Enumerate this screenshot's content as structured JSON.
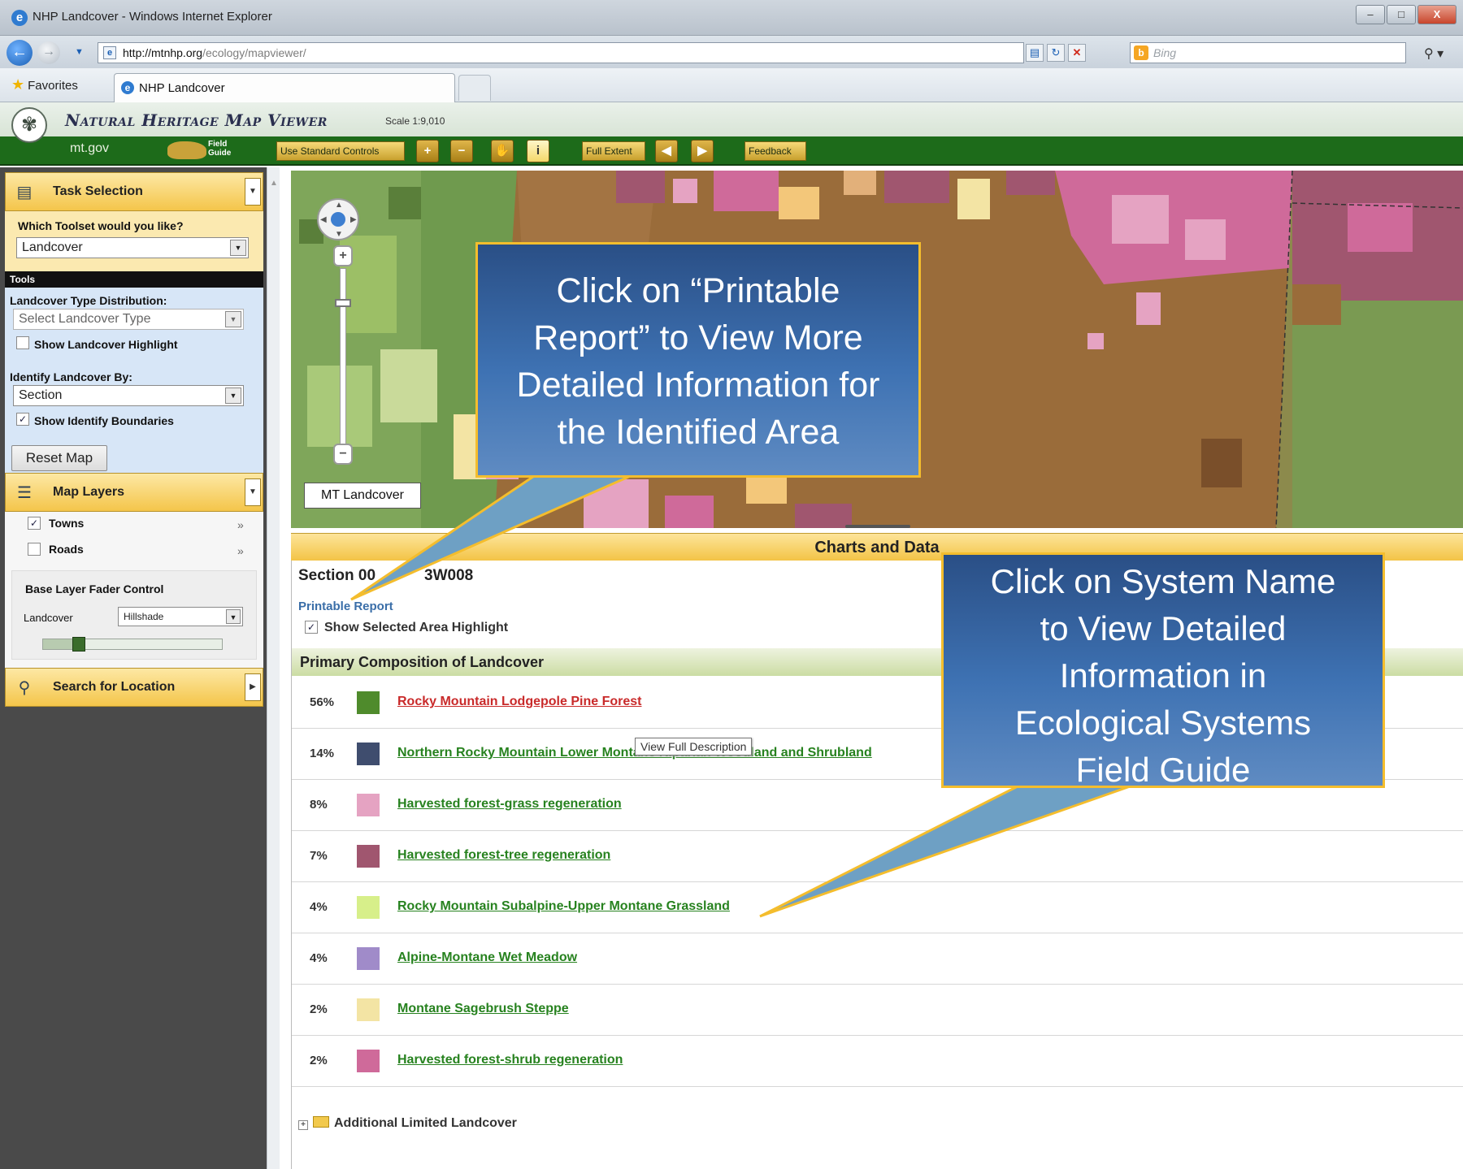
{
  "browser": {
    "window_title": "NHP Landcover - Windows Internet Explorer",
    "url_domain": "http://mtnhp.org",
    "url_path": "/ecology/mapviewer/",
    "search_placeholder": "Bing",
    "favorites_label": "Favorites",
    "tab_label": "NHP Landcover",
    "window_buttons": [
      "–",
      "□",
      "X"
    ]
  },
  "app": {
    "title": "Natural Heritage Map Viewer",
    "scale": "Scale 1:9,010",
    "mtgov": "mt.gov",
    "field_guide": "Field Guide",
    "toolbar": {
      "standard_controls": "Use Standard Controls",
      "full_extent": "Full Extent",
      "feedback": "Feedback"
    }
  },
  "panel": {
    "task_selection": "Task Selection",
    "toolset_question": "Which Toolset would you like?",
    "toolset_value": "Landcover",
    "tools_heading": "Tools",
    "distribution_label": "Landcover Type Distribution:",
    "distribution_placeholder": "Select Landcover Type",
    "show_highlight": "Show Landcover Highlight",
    "identify_label": "Identify Landcover By:",
    "identify_value": "Section",
    "show_boundaries": "Show Identify Boundaries",
    "reset_map": "Reset Map",
    "map_layers": "Map Layers",
    "layers": [
      {
        "label": "Towns",
        "checked": true
      },
      {
        "label": "Roads",
        "checked": false
      }
    ],
    "fader_heading": "Base Layer Fader Control",
    "fader_left": "Landcover",
    "fader_right": "Hillshade",
    "fader_level": 0.2,
    "search_location": "Search for Location"
  },
  "map": {
    "layer_label": "MT Landcover"
  },
  "charts": {
    "header": "Charts and Data",
    "section_title": "Section 00",
    "section_title_end": "3W008",
    "printable_report": "Printable Report",
    "show_selected": "Show Selected Area Highlight",
    "composition_header": "Primary Composition of Landcover",
    "tooltip": "View Full Description",
    "rows": [
      {
        "pct": "56%",
        "color": "#4f8b2c",
        "name": "Rocky Mountain Lodgepole Pine Forest",
        "hover": true
      },
      {
        "pct": "14%",
        "color": "#3f4d6e",
        "name": "Northern Rocky Mountain Lower Montane Riparian Woodland and Shrubland",
        "hover": false
      },
      {
        "pct": "8%",
        "color": "#e5a3c2",
        "name": "Harvested forest-grass regeneration",
        "hover": false
      },
      {
        "pct": "7%",
        "color": "#a0566f",
        "name": "Harvested forest-tree regeneration",
        "hover": false
      },
      {
        "pct": "4%",
        "color": "#d7ef8a",
        "name": "Rocky Mountain Subalpine-Upper Montane Grassland",
        "hover": false
      },
      {
        "pct": "4%",
        "color": "#a08bc9",
        "name": "Alpine-Montane Wet Meadow",
        "hover": false
      },
      {
        "pct": "2%",
        "color": "#f3e4a4",
        "name": "Montane Sagebrush Steppe",
        "hover": false
      },
      {
        "pct": "2%",
        "color": "#cf6a9a",
        "name": "Harvested forest-shrub regeneration",
        "hover": false
      }
    ],
    "additional": "Additional Limited Landcover"
  },
  "callouts": {
    "printable": [
      "Click on “Printable",
      "Report” to View More",
      "Detailed Information for",
      "the Identified Area"
    ],
    "system": [
      "Click on System Name",
      "to View Detailed",
      "Information in",
      "Ecological Systems",
      "Field Guide"
    ]
  }
}
